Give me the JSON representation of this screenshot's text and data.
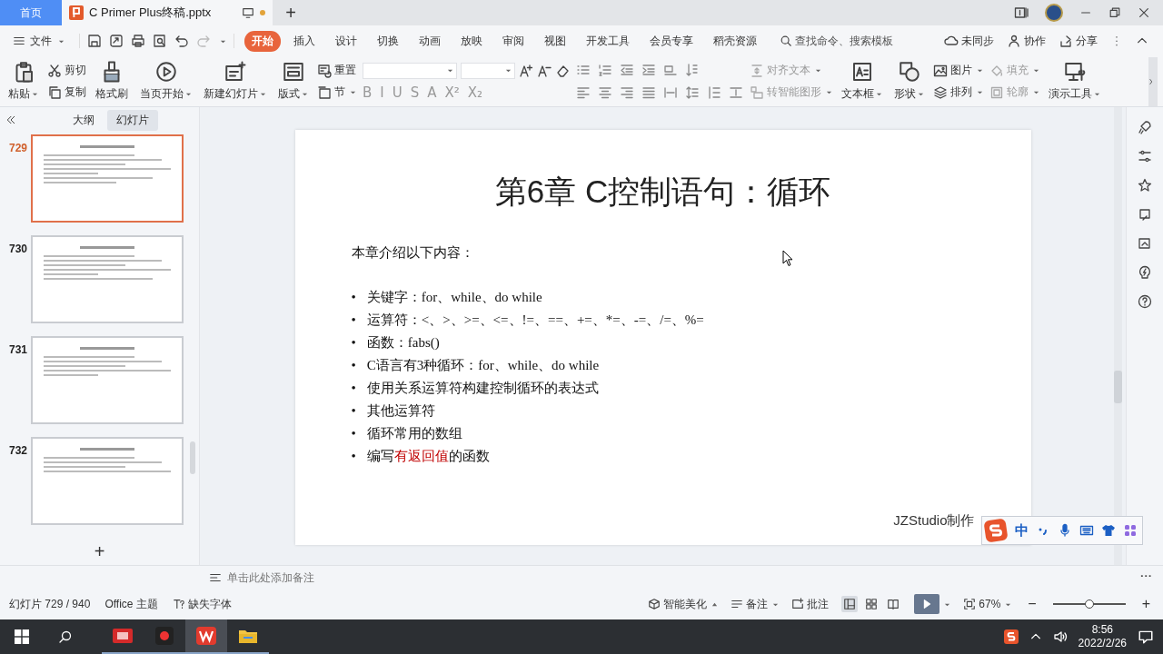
{
  "title_bar": {
    "home_tab": "首页",
    "doc_tab": {
      "title": "C Primer  Plus终稿.pptx",
      "modified": true
    },
    "new_tab": "+"
  },
  "menu_bar": {
    "file": "文件",
    "tabs": [
      {
        "label": "开始",
        "selected": true
      },
      {
        "label": "插入",
        "selected": false
      },
      {
        "label": "设计",
        "selected": false
      },
      {
        "label": "切换",
        "selected": false
      },
      {
        "label": "动画",
        "selected": false
      },
      {
        "label": "放映",
        "selected": false
      },
      {
        "label": "审阅",
        "selected": false
      },
      {
        "label": "视图",
        "selected": false
      },
      {
        "label": "开发工具",
        "selected": false
      },
      {
        "label": "会员专享",
        "selected": false
      },
      {
        "label": "稻壳资源",
        "selected": false
      }
    ],
    "search": {
      "placeholder": "查找命令、搜索模板"
    },
    "actions": [
      "未同步",
      "协作",
      "分享"
    ]
  },
  "ribbon": {
    "items": [
      {
        "kind": "big",
        "label": "粘贴",
        "dropdown": true
      },
      {
        "kind": "pair",
        "items": [
          {
            "label": "剪切",
            "dropdown": false,
            "disabled": false
          },
          {
            "label": "复制",
            "dropdown": false,
            "disabled": false
          }
        ]
      },
      {
        "kind": "big",
        "label": "格式刷",
        "dropdown": false
      },
      {
        "kind": "big",
        "label": "当页开始",
        "dropdown": true
      },
      {
        "kind": "big",
        "label": "新建幻灯片",
        "dropdown": true
      },
      {
        "kind": "big",
        "label": "版式",
        "dropdown": true
      },
      {
        "kind": "pair",
        "items": [
          {
            "label": "重置",
            "dropdown": false,
            "disabled": false
          },
          {
            "label": "节",
            "dropdown": true,
            "disabled": false
          }
        ]
      },
      {
        "kind": "font",
        "styles": [
          "B",
          "I",
          "U",
          "S",
          "A",
          "X²",
          "X₂"
        ]
      },
      {
        "kind": "paragraph"
      },
      {
        "kind": "pair",
        "items": [
          {
            "label": "对齐文本",
            "dropdown": true,
            "disabled": true
          },
          {
            "label": "转智能图形",
            "dropdown": true,
            "disabled": true
          }
        ]
      },
      {
        "kind": "big",
        "label": "文本框",
        "dropdown": true
      },
      {
        "kind": "big",
        "label": "形状",
        "dropdown": true
      },
      {
        "kind": "pair",
        "items": [
          {
            "label": "图片",
            "dropdown": true,
            "disabled": false
          },
          {
            "label": "排列",
            "dropdown": true,
            "disabled": false
          }
        ]
      },
      {
        "kind": "pair",
        "items": [
          {
            "label": "填充",
            "dropdown": true,
            "disabled": true
          },
          {
            "label": "轮廓",
            "dropdown": true,
            "disabled": true
          }
        ]
      },
      {
        "kind": "big",
        "label": "演示工具",
        "dropdown": true
      }
    ]
  },
  "left_panel": {
    "tabs": [
      {
        "label": "大纲",
        "selected": false
      },
      {
        "label": "幻灯片",
        "selected": true
      }
    ],
    "thumbnails": [
      {
        "number": "729",
        "selected": true
      },
      {
        "number": "730",
        "selected": false
      },
      {
        "number": "731",
        "selected": false
      },
      {
        "number": "732",
        "selected": false
      }
    ],
    "add_button": "+"
  },
  "slide": {
    "title": "第6章 C控制语句：循环",
    "intro": "本章介绍以下内容：",
    "bullets": [
      {
        "marker": "•",
        "text": "关键字：for、while、do while"
      },
      {
        "marker": "•",
        "text": "运算符：<、>、>=、<=、!=、==、+=、*=、-=、/=、%="
      },
      {
        "marker": "•",
        "text": "函数：fabs()"
      },
      {
        "marker": "•",
        "text": "C语言有3种循环：for、while、do while"
      },
      {
        "marker": "•",
        "text": "使用关系运算符构建控制循环的表达式"
      },
      {
        "marker": "•",
        "text": "其他运算符"
      },
      {
        "marker": "•",
        "text": "循环常用的数组"
      },
      {
        "marker": "•",
        "text": "编写",
        "highlighted_text": "有返回值",
        "text_after": "的函数"
      }
    ],
    "footer": "JZStudio制作"
  },
  "ime_bar": {
    "mode": "中"
  },
  "notes": {
    "placeholder": "单击此处添加备注"
  },
  "status_bar": {
    "slide_count": "幻灯片 729 / 940",
    "theme": "Office 主题",
    "missing_fonts": "缺失字体",
    "beautify": "智能美化",
    "notes": "备注",
    "comments": "批注",
    "views": [
      {
        "selected": true
      },
      {
        "selected": false
      },
      {
        "selected": false
      }
    ],
    "zoom": "67%",
    "zoom_out": "−",
    "zoom_in": "+",
    "zoom_level": {
      "level": 0.5
    }
  },
  "taskbar": {
    "apps": [
      {
        "selected": false
      },
      {
        "selected": false
      },
      {
        "selected": true
      },
      {
        "selected": false
      }
    ],
    "time": "8:56",
    "date": "2022/2/26"
  }
}
